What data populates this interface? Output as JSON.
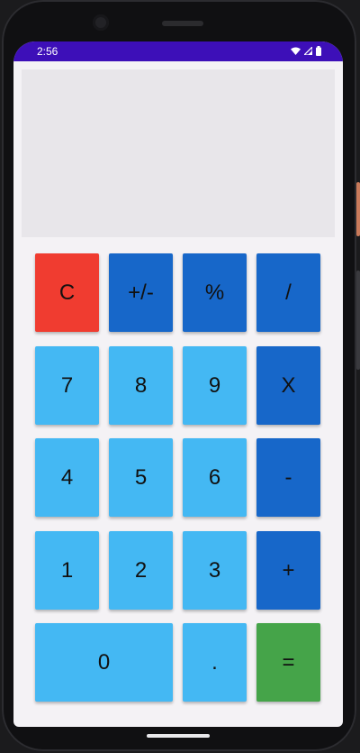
{
  "status": {
    "time": "2:56",
    "icons": [
      "wifi-icon",
      "signal-icon",
      "battery-icon"
    ]
  },
  "display": {
    "value": ""
  },
  "keys": {
    "clear": "C",
    "sign": "+/-",
    "percent": "%",
    "divide": "/",
    "seven": "7",
    "eight": "8",
    "nine": "9",
    "multiply": "X",
    "four": "4",
    "five": "5",
    "six": "6",
    "minus": "-",
    "one": "1",
    "two": "2",
    "three": "3",
    "plus": "+",
    "zero": "0",
    "decimal": ".",
    "equals": "="
  },
  "colors": {
    "clear": "#f03c30",
    "operator": "#1767c9",
    "digit": "#44b8f3",
    "equals": "#45a449",
    "statusbar": "#3d0fb8"
  }
}
